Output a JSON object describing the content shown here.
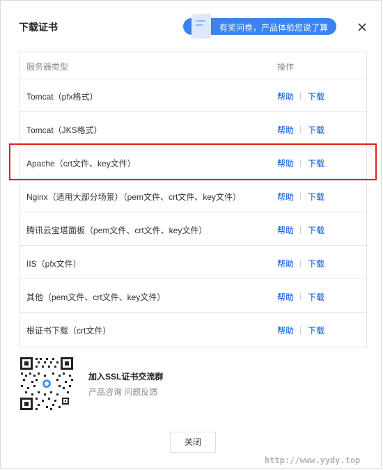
{
  "dialog": {
    "title": "下载证书",
    "banner_text": "有奖问卷，产品体验您说了算",
    "close_icon": "close-icon"
  },
  "table": {
    "header_name": "服务器类型",
    "header_op": "操作",
    "rows": [
      {
        "name": "Tomcat（pfx格式）",
        "help": "帮助",
        "sep": "|",
        "download": "下载"
      },
      {
        "name": "Tomcat（JKS格式）",
        "help": "帮助",
        "sep": "|",
        "download": "下载"
      },
      {
        "name": "Apache（crt文件、key文件）",
        "help": "帮助",
        "sep": "|",
        "download": "下载"
      },
      {
        "name": "Nginx（适用大部分场景）（pem文件、crt文件、key文件）",
        "help": "帮助",
        "sep": "|",
        "download": "下载"
      },
      {
        "name": "腾讯云宝塔面板（pem文件、crt文件、key文件）",
        "help": "帮助",
        "sep": "|",
        "download": "下载"
      },
      {
        "name": "IIS（pfx文件）",
        "help": "帮助",
        "sep": "|",
        "download": "下载"
      },
      {
        "name": "其他（pem文件、crt文件、key文件）",
        "help": "帮助",
        "sep": "|",
        "download": "下载"
      },
      {
        "name": "根证书下载（crt文件）",
        "help": "帮助",
        "sep": "|",
        "download": "下载"
      }
    ]
  },
  "group": {
    "title": "加入SSL证书交流群",
    "subtitle": "产品咨询 问题反馈"
  },
  "footer": {
    "close_label": "关闭"
  },
  "watermark": "http://www.yydy.top",
  "colors": {
    "link": "#0052d9",
    "highlight": "#e81b1b",
    "banner": "#3b83ed"
  }
}
